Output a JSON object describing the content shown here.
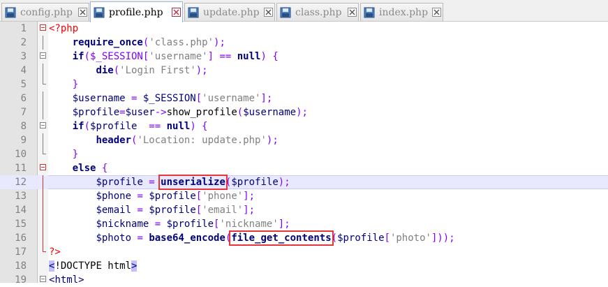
{
  "tabs": [
    {
      "label": "config.php",
      "active": false
    },
    {
      "label": "profile.php",
      "active": true
    },
    {
      "label": "update.php",
      "active": false
    },
    {
      "label": "class.php",
      "active": false
    },
    {
      "label": "index.php",
      "active": false
    }
  ],
  "lines": [
    {
      "num": "1"
    },
    {
      "num": "2"
    },
    {
      "num": "3"
    },
    {
      "num": "4"
    },
    {
      "num": "5"
    },
    {
      "num": "6"
    },
    {
      "num": "7"
    },
    {
      "num": "8"
    },
    {
      "num": "9"
    },
    {
      "num": "10"
    },
    {
      "num": "11"
    },
    {
      "num": "12"
    },
    {
      "num": "13"
    },
    {
      "num": "14"
    },
    {
      "num": "15"
    },
    {
      "num": "16"
    },
    {
      "num": "17"
    },
    {
      "num": "18"
    },
    {
      "num": "19"
    }
  ],
  "code": {
    "l1": {
      "open": "<?php"
    },
    "l2": {
      "kw": "require_once",
      "p1": "(",
      "s1": "'class.php'",
      "p2": ");"
    },
    "l3": {
      "kw": "if",
      "p1": "($_SESSION[",
      "s1": "'username'",
      "p2": "] == ",
      "k2": "null",
      "p3": ") {"
    },
    "l4": {
      "kw": "die",
      "p1": "(",
      "s1": "'Login First'",
      "p2": ");"
    },
    "l5": {
      "p1": "}"
    },
    "l6": {
      "v1": "$username",
      "p1": " = ",
      "v2": "$_SESSION",
      "p2": "[",
      "s1": "'username'",
      "p3": "];"
    },
    "l7": {
      "v1": "$profile",
      "p1": "=",
      "v2": "$user",
      "p2": "->",
      "f1": "show_profile",
      "p3": "(",
      "v3": "$username",
      "p4": ");"
    },
    "l8": {
      "kw": "if",
      "p1": "(",
      "v1": "$profile",
      "p2": "  == ",
      "k2": "null",
      "p3": ") {"
    },
    "l9": {
      "kw": "header",
      "p1": "(",
      "s1": "'Location: update.php'",
      "p2": ");"
    },
    "l10": {
      "p1": "}"
    },
    "l11": {
      "kw": "else",
      "p1": " {"
    },
    "l12": {
      "v1": "$profile",
      "p1": " = ",
      "kw": "unserialize",
      "p2": "(",
      "v2": "$profile",
      "p3": ");"
    },
    "l13": {
      "v1": "$phone",
      "p1": " = ",
      "v2": "$profile",
      "p2": "[",
      "s1": "'phone'",
      "p3": "];"
    },
    "l14": {
      "v1": "$email",
      "p1": " = ",
      "v2": "$profile",
      "p2": "[",
      "s1": "'email'",
      "p3": "];"
    },
    "l15": {
      "v1": "$nickname",
      "p1": " = ",
      "v2": "$profile",
      "p2": "[",
      "s1": "'nickname'",
      "p3": "];"
    },
    "l16": {
      "v1": "$photo",
      "p1": " = ",
      "kw": "base64_encode",
      "p2": "(",
      "kw2": "file_get_contents",
      "p3": "(",
      "v2": "$profile",
      "p4": "[",
      "s1": "'photo'",
      "p5": "]));"
    },
    "l17": {
      "close": "?>"
    },
    "l18": {
      "lt": "<",
      "doctype": "!DOCTYPE html",
      "gt": ">"
    },
    "l19": {
      "lt": "<",
      "tag": "html",
      "gt": ">"
    }
  }
}
